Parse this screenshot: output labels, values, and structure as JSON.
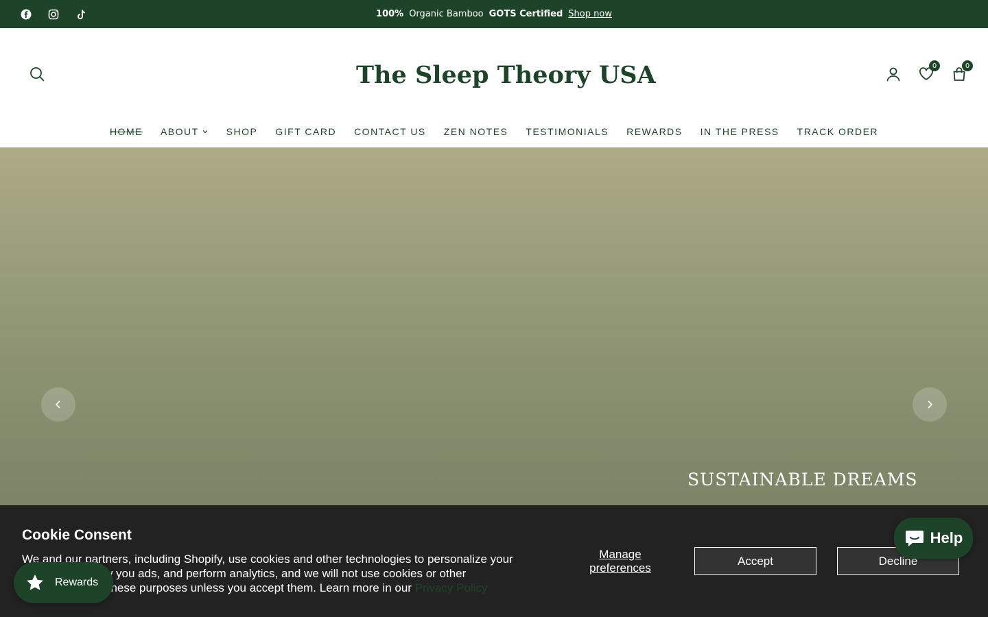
{
  "announcement": {
    "part1_bold": "100%",
    "part2": "Organic Bamboo",
    "part3_bold": "GOTS Certified",
    "link": "Shop now"
  },
  "social_icons": [
    "facebook-icon",
    "instagram-icon",
    "tiktok-icon"
  ],
  "header": {
    "logo_text": "The Sleep Theory USA",
    "wishlist_count": "0",
    "cart_count": "0"
  },
  "nav": {
    "items": [
      "HOME",
      "ABOUT",
      "SHOP",
      "GIFT CARD",
      "CONTACT US",
      "ZEN NOTES",
      "TESTIMONIALS",
      "REWARDS",
      "IN THE PRESS",
      "TRACK ORDER"
    ]
  },
  "hero": {
    "heading": "SUSTAINABLE DREAMS"
  },
  "cookie": {
    "title": "Cookie Consent",
    "body": "We and our partners, including Shopify, use cookies and other technologies to personalize your experience, show you ads, and perform analytics, and we will not use cookies or other technologies for these purposes unless you accept them. Learn more in our",
    "privacy_link": "Privacy Policy",
    "manage": "Manage preferences",
    "accept": "Accept",
    "decline": "Decline"
  },
  "rewards_label": "Rewards",
  "help_label": "Help",
  "colors": {
    "brand": "#1d4429",
    "cookie_bg": "#222222"
  }
}
